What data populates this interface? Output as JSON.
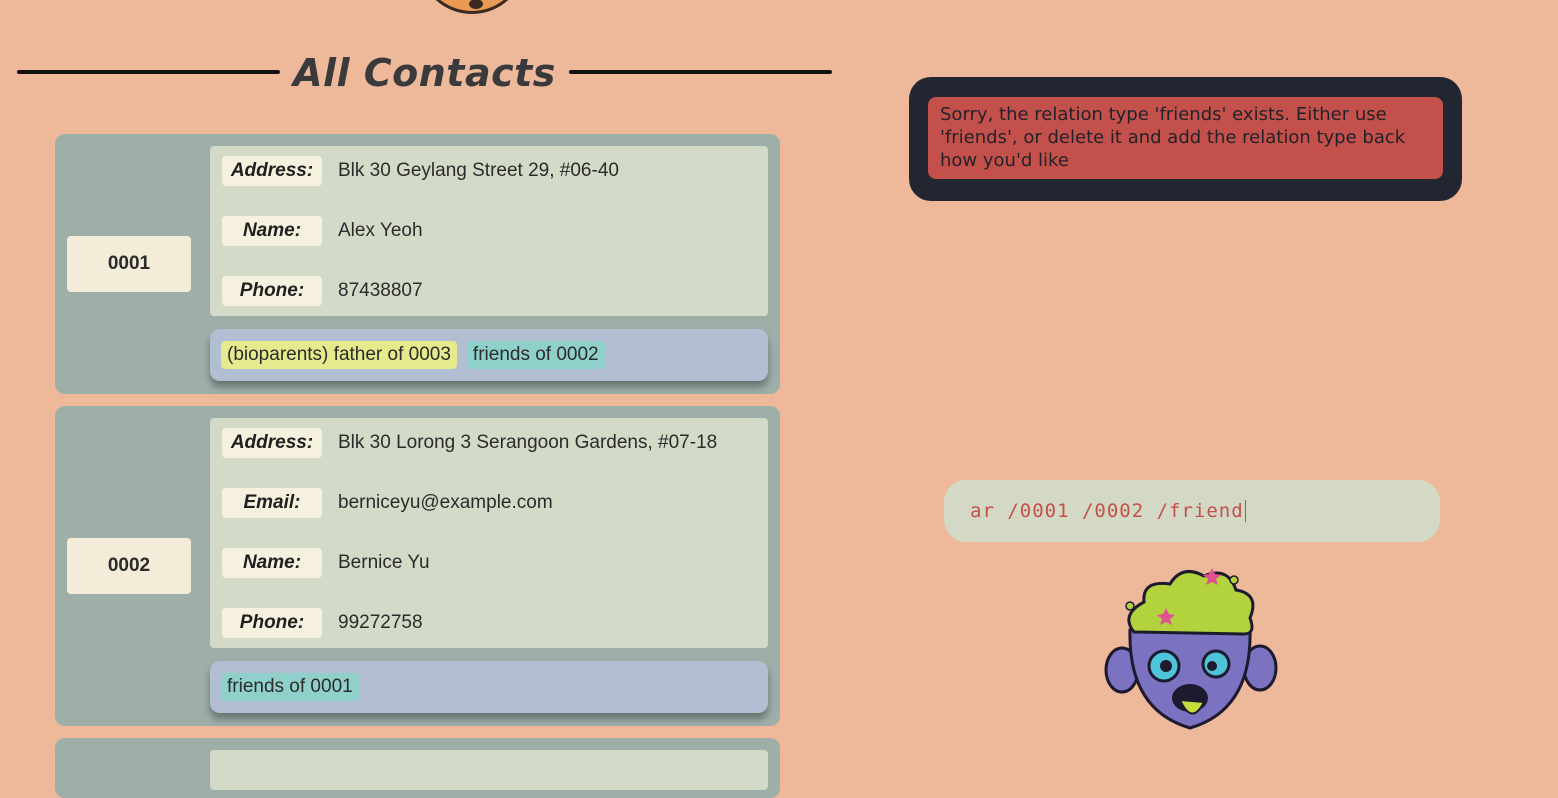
{
  "page": {
    "title": "All Contacts"
  },
  "contacts": [
    {
      "index": "0001",
      "fields": [
        {
          "label": "Address:",
          "value": "Blk 30 Geylang Street 29, #06-40"
        },
        {
          "label": "Name:",
          "value": "Alex Yeoh"
        },
        {
          "label": "Phone:",
          "value": "87438807"
        }
      ],
      "tags": [
        {
          "text": "(bioparents) father of 0003",
          "color": "#e5ea8c"
        },
        {
          "text": "friends of 0002",
          "color": "#8fd0cb"
        }
      ]
    },
    {
      "index": "0002",
      "fields": [
        {
          "label": "Address:",
          "value": "Blk 30 Lorong 3 Serangoon Gardens, #07-18"
        },
        {
          "label": "Email:",
          "value": "berniceyu@example.com"
        },
        {
          "label": "Name:",
          "value": "Bernice Yu"
        },
        {
          "label": "Phone:",
          "value": "99272758"
        }
      ],
      "tags": [
        {
          "text": "friends of 0001",
          "color": "#8fd0cb"
        }
      ]
    }
  ],
  "result": {
    "message": "Sorry, the relation type 'friends' exists. Either use 'friends', or delete it and add the relation type back how you'd like"
  },
  "command": {
    "value": "ar /0001 /0002 /friend"
  },
  "colors": {
    "background": "#edb99a",
    "card": "#9eafaa",
    "error": "#c4504b",
    "panel": "#222630"
  },
  "icons": {
    "top_mascot": "cookie-mascot-icon",
    "bottom_mascot": "zombie-mascot-icon"
  }
}
